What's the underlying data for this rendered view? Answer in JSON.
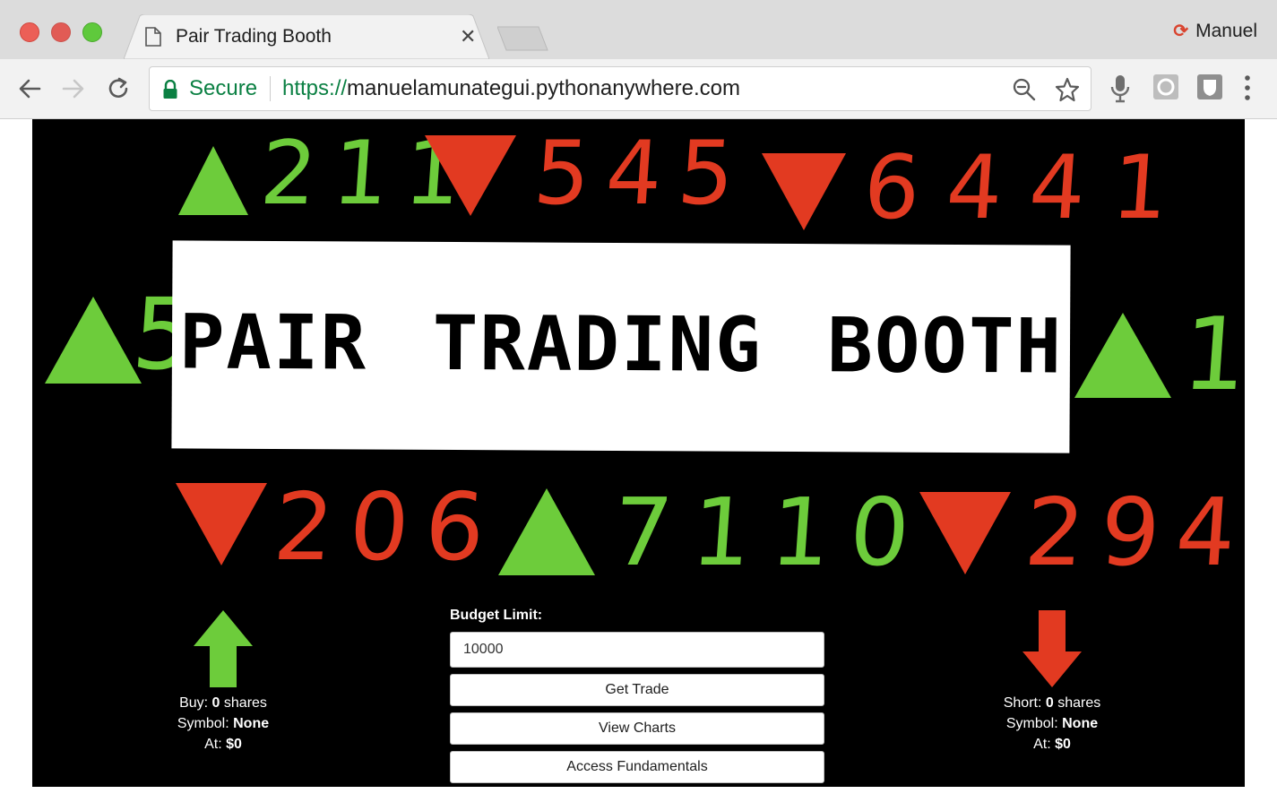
{
  "browser": {
    "tab_title": "Pair Trading Booth",
    "profile_name": "Manuel",
    "security_label": "Secure",
    "url_scheme": "https://",
    "url_host": "manuelamunategui.pythonanywhere.com"
  },
  "banner": {
    "title": "PAIR TRADING BOOTH",
    "tickers": [
      {
        "direction": "up",
        "color": "#6dcc3b",
        "value": "211"
      },
      {
        "direction": "down",
        "color": "#e23a21",
        "value": "545"
      },
      {
        "direction": "down",
        "color": "#e23a21",
        "value": "6441"
      },
      {
        "direction": "up",
        "color": "#6dcc3b",
        "value": "5"
      },
      {
        "direction": "up",
        "color": "#6dcc3b",
        "value": "1"
      },
      {
        "direction": "down",
        "color": "#e23a21",
        "value": "206"
      },
      {
        "direction": "up",
        "color": "#6dcc3b",
        "value": "7110"
      },
      {
        "direction": "down",
        "color": "#e23a21",
        "value": "294"
      }
    ]
  },
  "buy_panel": {
    "action_label": "Buy:",
    "shares_value": "0",
    "shares_unit": "shares",
    "symbol_label": "Symbol:",
    "symbol_value": "None",
    "at_label": "At:",
    "at_value": "$0",
    "arrow_color": "#6dcc3b"
  },
  "short_panel": {
    "action_label": "Short:",
    "shares_value": "0",
    "shares_unit": "shares",
    "symbol_label": "Symbol:",
    "symbol_value": "None",
    "at_label": "At:",
    "at_value": "$0",
    "arrow_color": "#e23a21"
  },
  "form": {
    "budget_label": "Budget Limit:",
    "budget_value": "10000",
    "get_trade_label": "Get Trade",
    "view_charts_label": "View Charts",
    "access_fundamentals_label": "Access Fundamentals"
  }
}
